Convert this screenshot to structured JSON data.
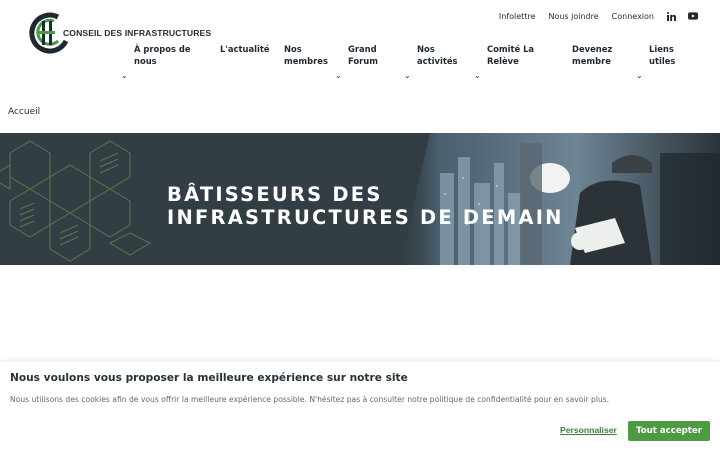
{
  "header": {
    "logo_text": "CONSEIL DES INFRASTRUCTURES",
    "utility_links": [
      "Infolettre",
      "Nous joindre",
      "Connexion"
    ],
    "social": [
      "linkedin-icon",
      "youtube-icon"
    ]
  },
  "nav": {
    "items": [
      {
        "label": "À propos de\nnous",
        "has_dropdown": true
      },
      {
        "label": "L'actualité",
        "has_dropdown": false
      },
      {
        "label": "Nos\nmembres",
        "has_dropdown": true
      },
      {
        "label": "Grand\nForum",
        "has_dropdown": false
      },
      {
        "label": "Nos\nactivités",
        "has_dropdown": true
      },
      {
        "label": "Comité La\nRelève",
        "has_dropdown": true
      },
      {
        "label": "Devenez\nmembre",
        "has_dropdown": true
      },
      {
        "label": "Liens\nutiles",
        "has_dropdown": false
      }
    ],
    "chevron": "⌄"
  },
  "breadcrumb": {
    "label": "Accueil"
  },
  "hero": {
    "title": "BÂTISSEURS DES\nINFRASTRUCTURES DE DEMAIN"
  },
  "cookie_banner": {
    "title": "Nous voulons vous proposer la meilleure expérience sur notre site",
    "text": "Nous utilisons des cookies afin de vous offrir la meilleure expérience possible. N'hésitez pas à consulter notre politique de confidentialité pour en savoir plus.",
    "customize_label": "Personnaliser",
    "accept_label": "Tout accepter"
  },
  "colors": {
    "brand_green": "#4e9a43",
    "dark_slate": "#323d44",
    "text_dark": "#1f2a30"
  }
}
